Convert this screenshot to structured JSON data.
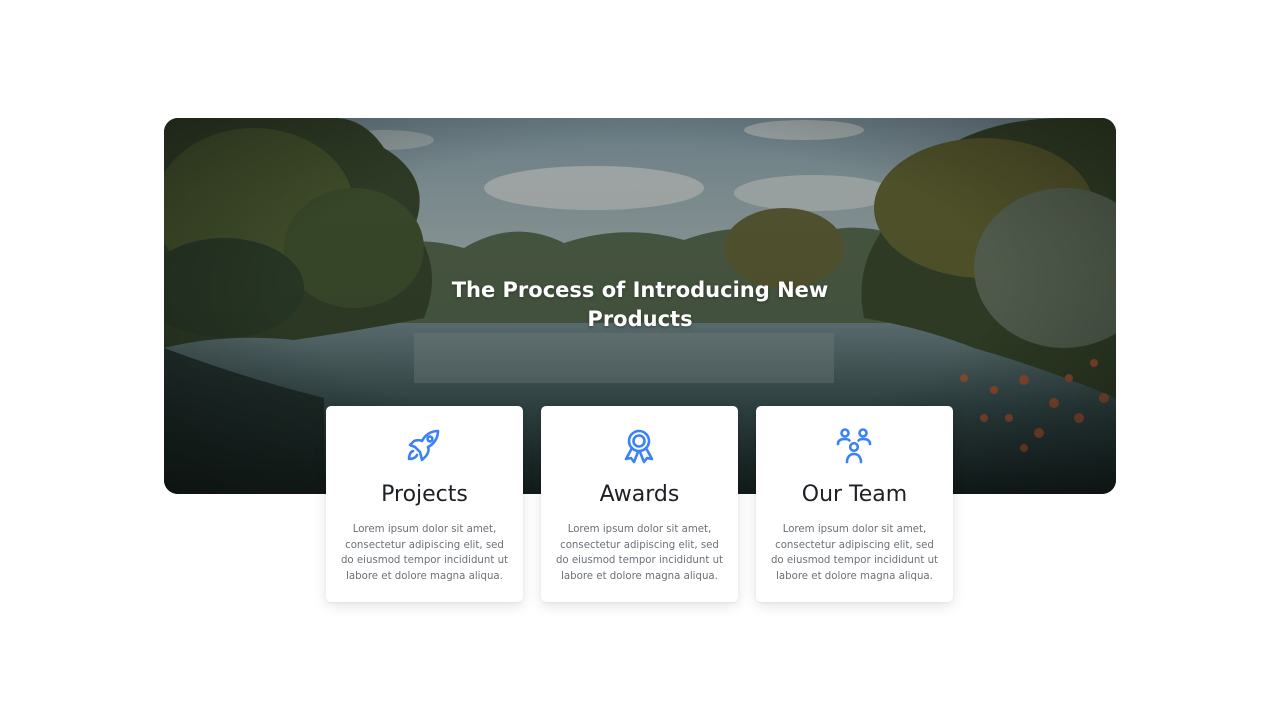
{
  "hero": {
    "title": "The Process of Introducing New Products"
  },
  "cards": [
    {
      "title": "Projects",
      "icon": "rocket-icon",
      "text": "Lorem ipsum dolor sit amet, consectetur adipiscing elit, sed do eiusmod tempor incididunt ut labore et dolore magna aliqua."
    },
    {
      "title": "Awards",
      "icon": "award-icon",
      "text": "Lorem ipsum dolor sit amet, consectetur adipiscing elit, sed do eiusmod tempor incididunt ut labore et dolore magna aliqua."
    },
    {
      "title": "Our Team",
      "icon": "team-icon",
      "text": "Lorem ipsum dolor sit amet, consectetur adipiscing elit, sed do eiusmod tempor incididunt ut labore et dolore magna aliqua."
    }
  ],
  "colors": {
    "accent": "#3b82f6",
    "heading": "#1d2024",
    "body_text": "#6b7178"
  }
}
